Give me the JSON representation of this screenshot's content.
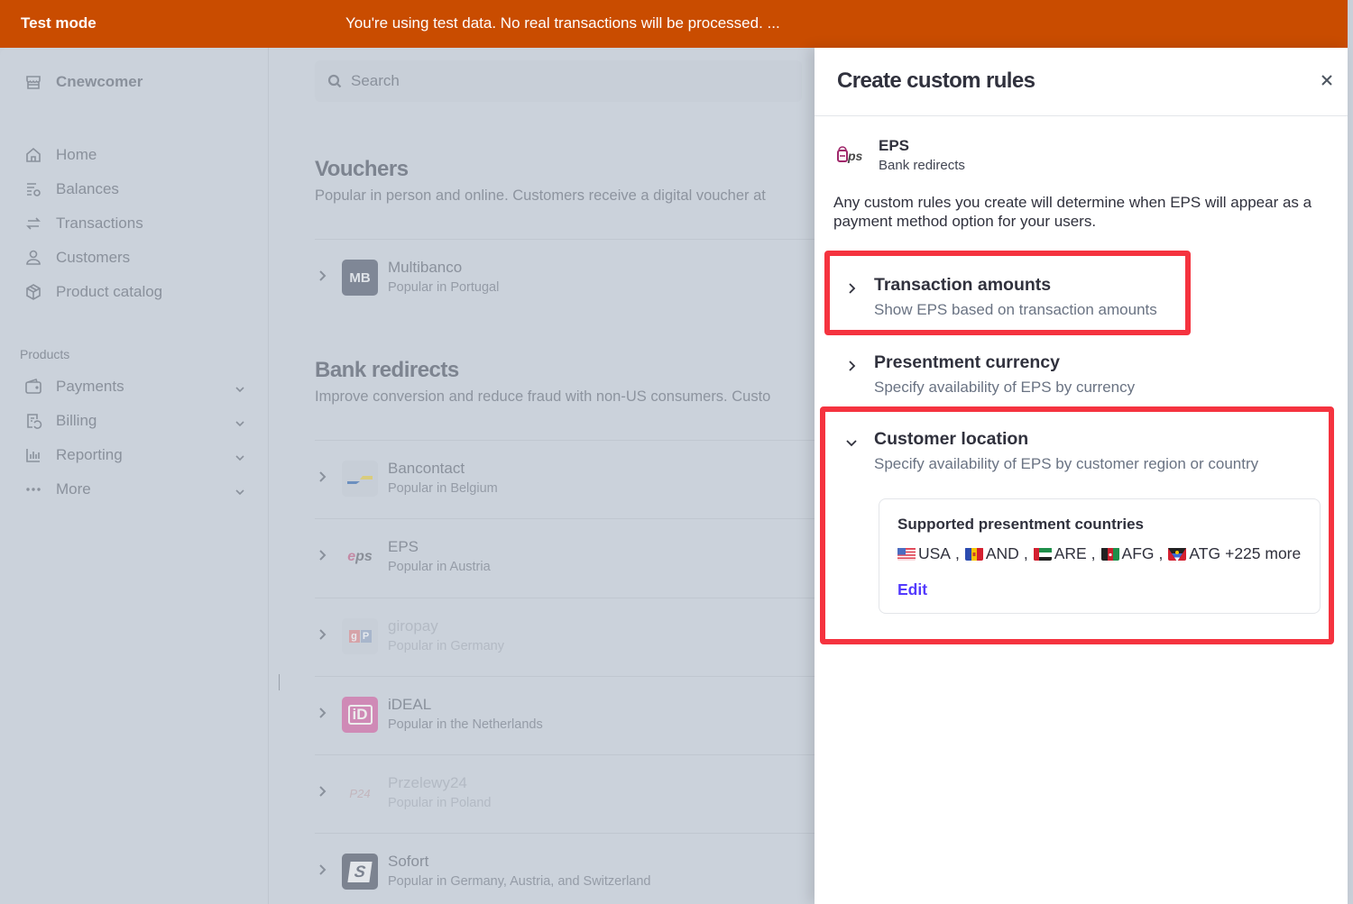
{
  "banner": {
    "label": "Test mode",
    "message": "You're using test data. No real transactions will be processed. ..."
  },
  "sidebar": {
    "account_name": "Cnewcomer",
    "nav": [
      {
        "label": "Home",
        "icon": "home-icon"
      },
      {
        "label": "Balances",
        "icon": "balances-icon"
      },
      {
        "label": "Transactions",
        "icon": "transactions-icon"
      },
      {
        "label": "Customers",
        "icon": "customers-icon"
      },
      {
        "label": "Product catalog",
        "icon": "product-catalog-icon"
      }
    ],
    "products_heading": "Products",
    "products": [
      {
        "label": "Payments",
        "icon": "wallet-icon"
      },
      {
        "label": "Billing",
        "icon": "billing-icon"
      },
      {
        "label": "Reporting",
        "icon": "reporting-icon"
      },
      {
        "label": "More",
        "icon": "more-dots-icon"
      }
    ]
  },
  "main": {
    "search_placeholder": "Search",
    "sections": [
      {
        "title": "Vouchers",
        "description": "Popular in person and online. Customers receive a digital voucher at",
        "methods": [
          {
            "name": "Multibanco",
            "subtitle": "Popular in Portugal",
            "logo_text": "MB"
          }
        ]
      },
      {
        "title": "Bank redirects",
        "description": "Improve conversion and reduce fraud with non-US consumers. Custo",
        "methods": [
          {
            "name": "Bancontact",
            "subtitle": "Popular in Belgium"
          },
          {
            "name": "EPS",
            "subtitle": "Popular in Austria",
            "logo_text": "eps"
          },
          {
            "name": "giropay",
            "subtitle": "Popular in Germany",
            "logo_text": "gP"
          },
          {
            "name": "iDEAL",
            "subtitle": "Popular in the Netherlands",
            "logo_text": "iD"
          },
          {
            "name": "Przelewy24",
            "subtitle": "Popular in Poland",
            "logo_text": "P24"
          },
          {
            "name": "Sofort",
            "subtitle": "Popular in Germany, Austria, and Switzerland",
            "logo_text": "S"
          }
        ]
      }
    ]
  },
  "drawer": {
    "title": "Create custom rules",
    "method_name": "EPS",
    "method_category": "Bank redirects",
    "method_logo_text": "eps",
    "intro": "Any custom rules you create will determine when EPS will appear as a payment method option for your users.",
    "rules": [
      {
        "title": "Transaction amounts",
        "description": "Show EPS based on transaction amounts",
        "expanded": false
      },
      {
        "title": "Presentment currency",
        "description": "Specify availability of EPS by currency",
        "expanded": false
      },
      {
        "title": "Customer location",
        "description": "Specify availability of EPS by customer region or country",
        "expanded": true
      }
    ],
    "countries_card": {
      "heading": "Supported presentment countries",
      "countries": [
        "USA",
        "AND",
        "ARE",
        "AFG",
        "ATG"
      ],
      "separator": ",",
      "more_text": "+225 more",
      "edit_label": "Edit"
    }
  },
  "colors": {
    "banner": "#c94c00",
    "highlight": "#f5333f",
    "link": "#533afd"
  }
}
